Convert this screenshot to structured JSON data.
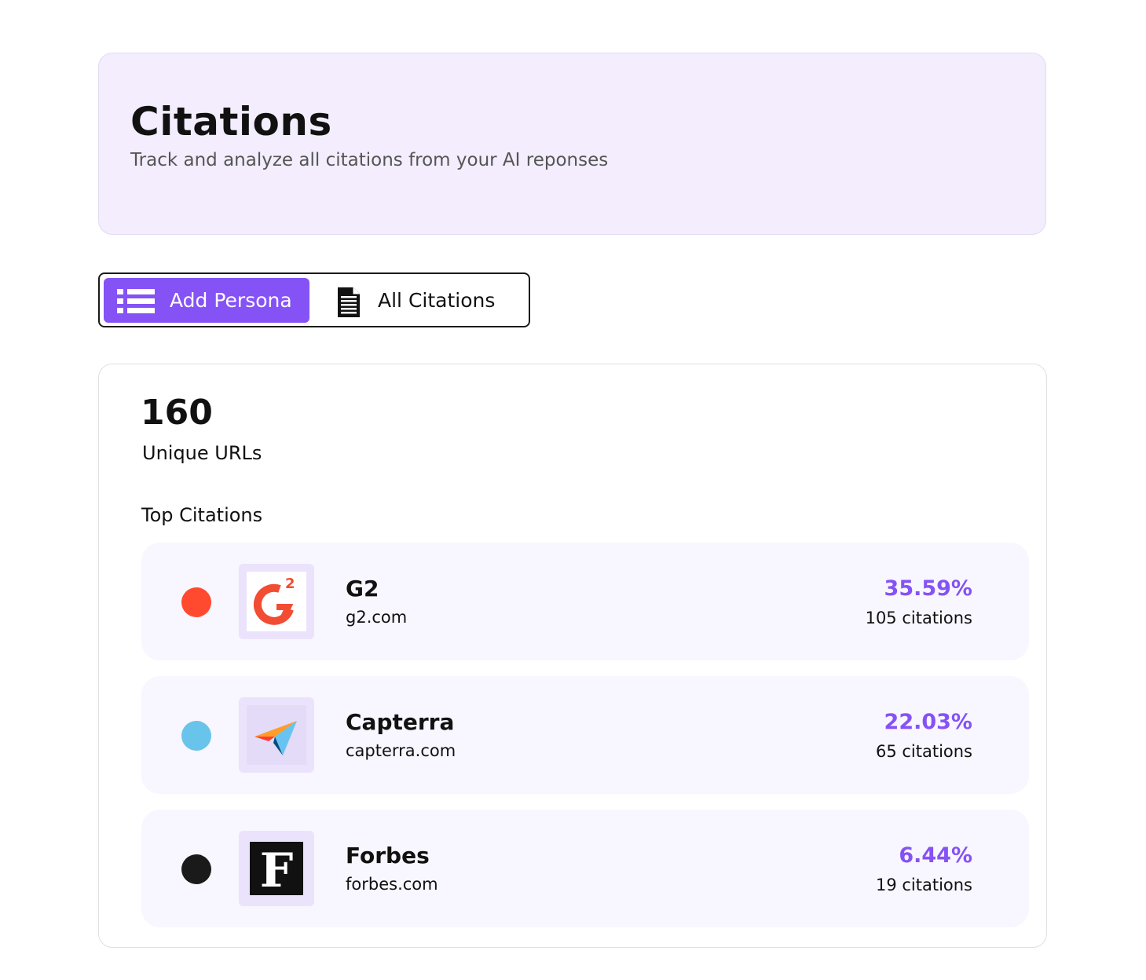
{
  "header": {
    "title": "Citations",
    "subtitle": "Track and analyze all citations from your AI reponses"
  },
  "tabs": [
    {
      "label": "Add Persona",
      "icon": "list-icon",
      "active": true
    },
    {
      "label": "All Citations",
      "icon": "document-icon",
      "active": false
    }
  ],
  "summary": {
    "unique_urls_count": "160",
    "unique_urls_label": "Unique URLs",
    "section_label": "Top Citations"
  },
  "citations": [
    {
      "name": "G2",
      "domain": "g2.com",
      "percent": "35.59%",
      "count": "105 citations",
      "dot_color": "#ff4a2f",
      "logo": "g2-logo"
    },
    {
      "name": "Capterra",
      "domain": "capterra.com",
      "percent": "22.03%",
      "count": "65 citations",
      "dot_color": "#68c4ea",
      "logo": "capterra-logo"
    },
    {
      "name": "Forbes",
      "domain": "forbes.com",
      "percent": "6.44%",
      "count": "19 citations",
      "dot_color": "#1a1a1a",
      "logo": "forbes-logo"
    }
  ],
  "colors": {
    "accent": "#8552f5",
    "header_bg": "#f3edfd",
    "row_bg": "#f8f6fe",
    "logo_frame_bg": "#ebe3fb"
  }
}
